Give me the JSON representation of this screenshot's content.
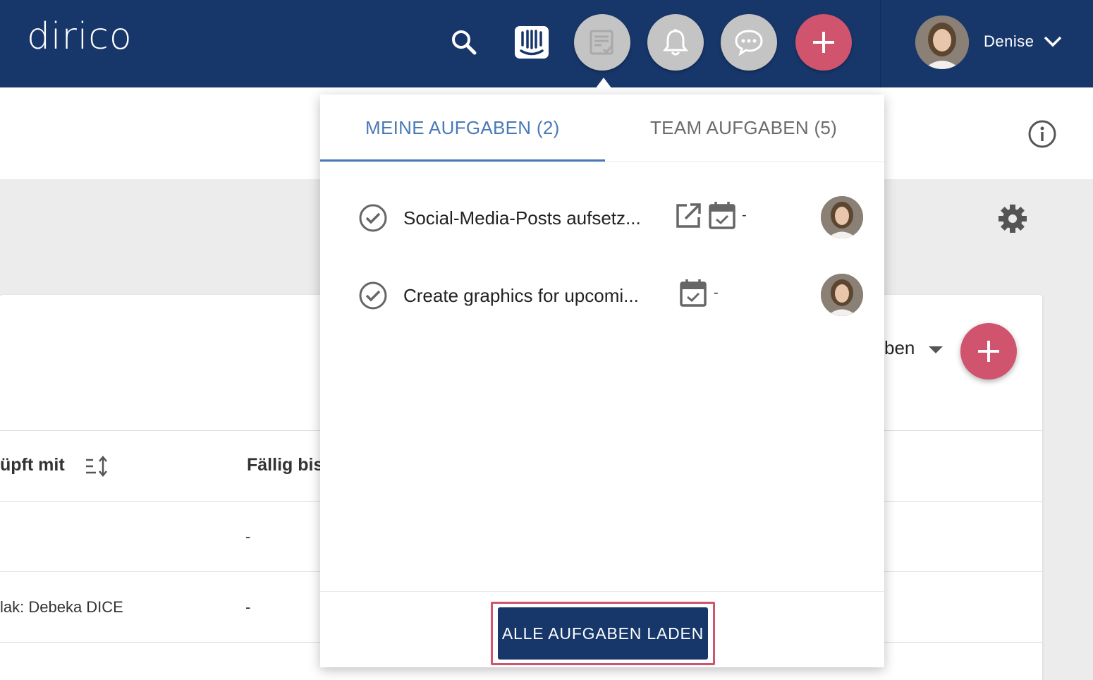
{
  "header": {
    "logo": "dirico",
    "user_name": "Denise",
    "icons": [
      "search-icon",
      "intercom-icon",
      "tasks-icon",
      "bell-icon",
      "chat-icon",
      "plus-icon"
    ]
  },
  "colors": {
    "navy": "#17376b",
    "accent_red": "#d0546e",
    "tab_blue": "#4a79b8",
    "grey_button": "#c4c4c4"
  },
  "background": {
    "filter_label": "ben",
    "table": {
      "headers": [
        "üpft mit",
        "Fällig bis"
      ],
      "rows": [
        {
          "linked": "",
          "due": "-"
        },
        {
          "linked": "lak: Debeka DICE",
          "due": "-"
        }
      ]
    }
  },
  "tasks_popup": {
    "tabs": [
      {
        "label": "MEINE AUFGABEN (2)",
        "active": true
      },
      {
        "label": "TEAM AUFGABEN (5)",
        "active": false
      }
    ],
    "tasks": [
      {
        "title": "Social-Media-Posts aufsetz...",
        "has_link": true,
        "due": "-"
      },
      {
        "title": "Create graphics for upcomi...",
        "has_link": false,
        "due": "-"
      }
    ],
    "load_all_label": "ALLE AUFGABEN LADEN"
  }
}
